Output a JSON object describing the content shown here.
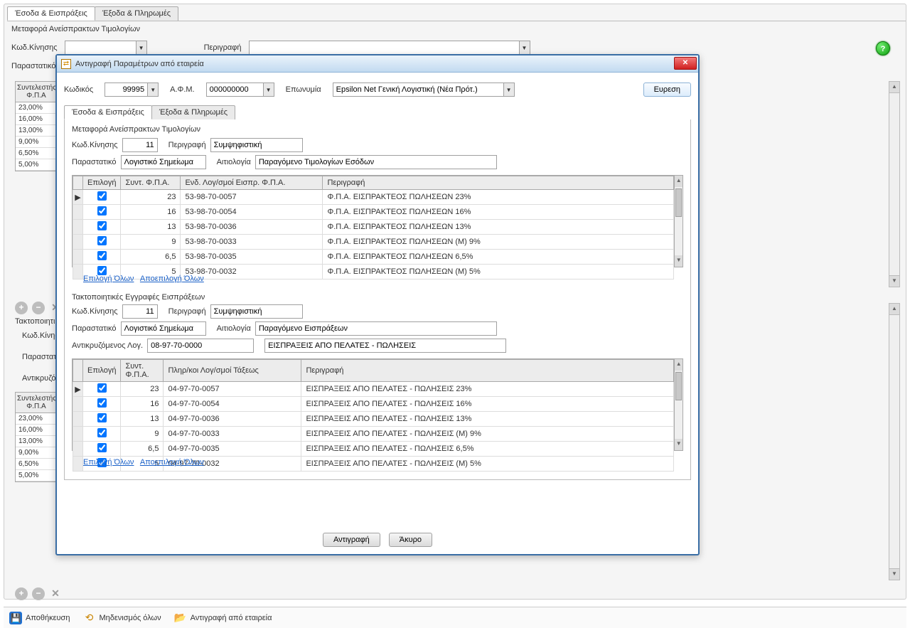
{
  "bg": {
    "tab1": "Έσοδα & Εισπράξεις",
    "tab2": "Έξοδα & Πληρωμές",
    "sectionTitle": "Μεταφορά Ανείσπρακτων Τιμολογίων",
    "kodKinisis": "Κωδ.Κίνησης",
    "perigrafi": "Περιγραφή",
    "parastatiko": "Παραστατικό",
    "gridHeader": "Συντελεστής Φ.Π.Α",
    "rates": [
      "23,00%",
      "16,00%",
      "13,00%",
      "9,00%",
      "6,50%",
      "5,00%"
    ],
    "section2label": "Τακτοποιητικές",
    "antikriz": "Αντικρυζό",
    "kodKinisis2": "Κωδ.Κίνηση"
  },
  "modal": {
    "title": "Αντιγραφή Παραμέτρων από εταιρεία",
    "kodikos": "Κωδικός",
    "kodikosValue": "99995",
    "afm": "Α.Φ.Μ.",
    "afmValue": "000000000",
    "eponimia": "Επωνυμία",
    "eponimiaValue": "Epsilon Net Γενική Λογιστική (Νέα Πρότ.)",
    "search": "Ευρεση",
    "tab1": "Έσοδα & Εισπράξεις",
    "tab2": "Έξοδα & Πληρωμές",
    "sec1": {
      "title": "Μεταφορά Ανείσπρακτων Τιμολογίων",
      "kodLabel": "Κωδ.Κίνησης",
      "kodValue": "11",
      "perLabel": "Περιγραφή",
      "perValue": "Συμψηφιστική",
      "parLabel": "Παραστατικό",
      "parValue": "Λογιστικό Σημείωμα",
      "aitLabel": "Αιτιολογία",
      "aitValue": "Παραγόμενο Τιμολογίων Εσόδων",
      "cols": {
        "c0": "Επιλογή",
        "c1": "Συντ. Φ.Π.Α.",
        "c2": "Ενδ. Λογ/σμοί Εισπρ. Φ.Π.Α.",
        "c3": "Περιγραφή"
      },
      "rows": [
        {
          "rate": "23",
          "acct": "53-98-70-0057",
          "desc": "Φ.Π.Α. ΕΙΣΠΡΑΚΤΕΟΣ ΠΩΛΗΣΕΩΝ 23%"
        },
        {
          "rate": "16",
          "acct": "53-98-70-0054",
          "desc": "Φ.Π.Α. ΕΙΣΠΡΑΚΤΕΟΣ ΠΩΛΗΣΕΩΝ 16%"
        },
        {
          "rate": "13",
          "acct": "53-98-70-0036",
          "desc": "Φ.Π.Α. ΕΙΣΠΡΑΚΤΕΟΣ ΠΩΛΗΣΕΩΝ 13%"
        },
        {
          "rate": "9",
          "acct": "53-98-70-0033",
          "desc": "Φ.Π.Α. ΕΙΣΠΡΑΚΤΕΟΣ ΠΩΛΗΣΕΩΝ (Μ) 9%"
        },
        {
          "rate": "6,5",
          "acct": "53-98-70-0035",
          "desc": "Φ.Π.Α. ΕΙΣΠΡΑΚΤΕΟΣ ΠΩΛΗΣΕΩΝ 6,5%"
        },
        {
          "rate": "5",
          "acct": "53-98-70-0032",
          "desc": "Φ.Π.Α. ΕΙΣΠΡΑΚΤΕΟΣ ΠΩΛΗΣΕΩΝ (Μ) 5%"
        }
      ]
    },
    "sec2": {
      "title": "Τακτοποιητικές Εγγραφές Εισπράξεων",
      "kodLabel": "Κωδ.Κίνησης",
      "kodValue": "11",
      "perLabel": "Περιγραφή",
      "perValue": "Συμψηφιστική",
      "parLabel": "Παραστατικό",
      "parValue": "Λογιστικό Σημείωμα",
      "aitLabel": "Αιτιολογία",
      "aitValue": "Παραγόμενο Εισπράξεων",
      "antLabel": "Αντικρυζόμενος Λογ.",
      "antValue": "08-97-70-0000",
      "antDesc": "ΕΙΣΠΡΑΞΕΙΣ ΑΠΟ ΠΕΛΑΤΕΣ - ΠΩΛΗΣΕΙΣ",
      "cols": {
        "c0": "Επιλογή",
        "c1": "Συντ. Φ.Π.Α.",
        "c2": "Πληρ/κοι Λογ/σμοί Τάξεως",
        "c3": "Περιγραφή"
      },
      "rows": [
        {
          "rate": "23",
          "acct": "04-97-70-0057",
          "desc": "ΕΙΣΠΡΑΞΕΙΣ ΑΠΟ ΠΕΛΑΤΕΣ - ΠΩΛΗΣΕΙΣ 23%"
        },
        {
          "rate": "16",
          "acct": "04-97-70-0054",
          "desc": "ΕΙΣΠΡΑΞΕΙΣ ΑΠΟ ΠΕΛΑΤΕΣ - ΠΩΛΗΣΕΙΣ 16%"
        },
        {
          "rate": "13",
          "acct": "04-97-70-0036",
          "desc": "ΕΙΣΠΡΑΞΕΙΣ ΑΠΟ ΠΕΛΑΤΕΣ - ΠΩΛΗΣΕΙΣ 13%"
        },
        {
          "rate": "9",
          "acct": "04-97-70-0033",
          "desc": "ΕΙΣΠΡΑΞΕΙΣ ΑΠΟ ΠΕΛΑΤΕΣ - ΠΩΛΗΣΕΙΣ (Μ) 9%"
        },
        {
          "rate": "6,5",
          "acct": "04-97-70-0035",
          "desc": "ΕΙΣΠΡΑΞΕΙΣ ΑΠΟ ΠΕΛΑΤΕΣ - ΠΩΛΗΣΕΙΣ 6,5%"
        },
        {
          "rate": "5",
          "acct": "04-97-70-0032",
          "desc": "ΕΙΣΠΡΑΞΕΙΣ ΑΠΟ ΠΕΛΑΤΕΣ - ΠΩΛΗΣΕΙΣ (Μ) 5%"
        }
      ]
    },
    "selectAll": "Επιλογή Όλων",
    "deselectAll": "Αποεπιλογή Όλων",
    "copy": "Αντιγραφή",
    "cancel": "Άκυρο"
  },
  "bottom": {
    "save": "Αποθήκευση",
    "reset": "Μηδενισμός όλων",
    "copy": "Αντιγραφή από εταιρεία"
  }
}
